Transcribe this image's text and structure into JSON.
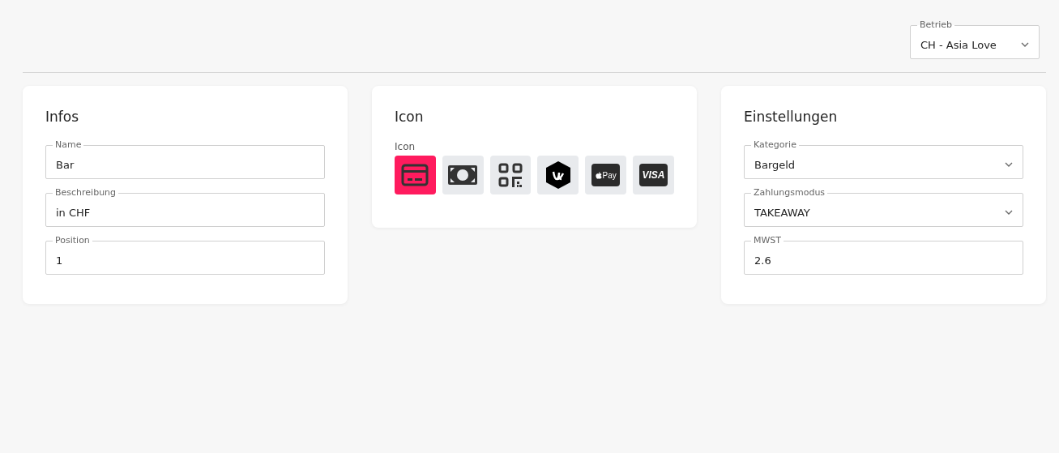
{
  "header": {
    "select": {
      "label": "Betrieb",
      "value": "CH - Asia Love"
    }
  },
  "infos": {
    "title": "Infos",
    "fields": [
      {
        "label": "Name",
        "value": "Bar"
      },
      {
        "label": "Beschreibung",
        "value": "in CHF"
      },
      {
        "label": "Position",
        "value": "1"
      }
    ]
  },
  "icon": {
    "title": "Icon",
    "label": "Icon",
    "options": [
      {
        "kind": "card",
        "selected": true
      },
      {
        "kind": "cash",
        "selected": false
      },
      {
        "kind": "qr",
        "selected": false
      },
      {
        "kind": "twint",
        "selected": false
      },
      {
        "kind": "applepay",
        "text": "Pay",
        "selected": false
      },
      {
        "kind": "visa",
        "text": "VISA",
        "selected": false
      }
    ]
  },
  "settings": {
    "title": "Einstellungen",
    "fields": [
      {
        "kind": "select",
        "label": "Kategorie",
        "value": "Bargeld"
      },
      {
        "kind": "select",
        "label": "Zahlungsmodus",
        "value": "TAKEAWAY"
      },
      {
        "kind": "input",
        "label": "MWST",
        "value": "2.6"
      }
    ]
  }
}
